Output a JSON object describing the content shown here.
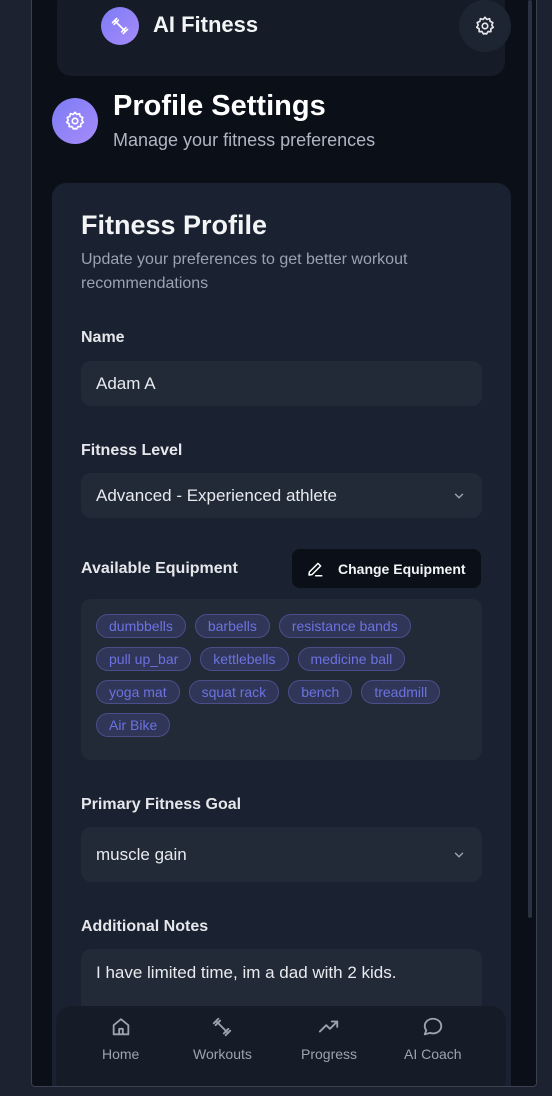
{
  "app": {
    "title": "AI Fitness"
  },
  "page": {
    "title": "Profile Settings",
    "subtitle": "Manage your fitness preferences"
  },
  "card": {
    "title": "Fitness Profile",
    "description": "Update your preferences to get better workout recommendations"
  },
  "form": {
    "name_label": "Name",
    "name_value": "Adam A",
    "level_label": "Fitness Level",
    "level_value": "Advanced - Experienced athlete",
    "equipment_label": "Available Equipment",
    "change_equipment_label": "Change Equipment",
    "equipment": [
      "dumbbells",
      "barbells",
      "resistance bands",
      "pull up_bar",
      "kettlebells",
      "medicine ball",
      "yoga mat",
      "squat rack",
      "bench",
      "treadmill",
      "Air Bike"
    ],
    "goal_label": "Primary Fitness Goal",
    "goal_value": "muscle gain",
    "notes_label": "Additional Notes",
    "notes_value": "I have limited time, im a dad with 2 kids."
  },
  "nav": {
    "items": [
      {
        "label": "Home",
        "icon": "home-icon"
      },
      {
        "label": "Workouts",
        "icon": "dumbbell-icon"
      },
      {
        "label": "Progress",
        "icon": "trending-up-icon"
      },
      {
        "label": "AI Coach",
        "icon": "chat-bubble-icon"
      }
    ]
  },
  "colors": {
    "accent": "#8b80f9",
    "chip_text": "#6d72e0",
    "background": "#0b0f17",
    "card": "#1a2130"
  }
}
